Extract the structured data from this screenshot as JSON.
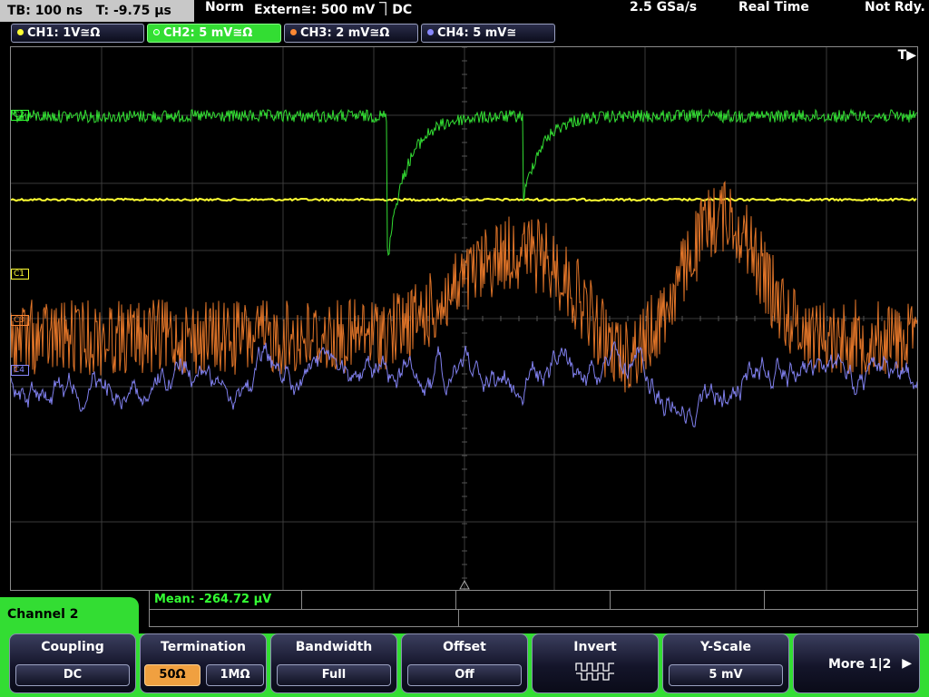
{
  "topbar": {
    "timebase": "TB: 100 ns",
    "trigger_time": "T: -9.75 µs",
    "mode": "Norm",
    "trigger_source": "Extern≅: 500 mV ⏋DC",
    "sample_rate": "2.5 GSa/s",
    "acq_mode": "Real Time",
    "status": "Not Rdy."
  },
  "channels": [
    {
      "label": "CH1: 1V≅Ω",
      "color": "#ffff33",
      "active": false
    },
    {
      "label": "CH2: 5 mV≅Ω",
      "color": "#33ff33",
      "active": true
    },
    {
      "label": "CH3: 2 mV≅Ω",
      "color": "#ff8833",
      "active": false
    },
    {
      "label": "CH4: 5 mV≅",
      "color": "#8888ff",
      "active": false
    }
  ],
  "markers": {
    "trigger_pos": "T▶",
    "c2": "C2",
    "c1": "C1",
    "c3": "C3",
    "c4": "C4"
  },
  "measurement": {
    "mean": "Mean: -264.72 µV"
  },
  "panel": {
    "title": "Channel 2"
  },
  "softkeys": {
    "coupling": {
      "title": "Coupling",
      "value": "DC"
    },
    "termination": {
      "title": "Termination",
      "option_a": "50Ω",
      "option_b": "1MΩ",
      "selected": "50Ω"
    },
    "bandwidth": {
      "title": "Bandwidth",
      "value": "Full"
    },
    "offset": {
      "title": "Offset",
      "value": "Off"
    },
    "invert": {
      "title": "Invert"
    },
    "yscale": {
      "title": "Y-Scale",
      "value": "5 mV"
    },
    "more": {
      "label": "More 1|2"
    }
  },
  "colors": {
    "ch1": "#ffff33",
    "ch2": "#33ff33",
    "ch3": "#ff8833",
    "ch4": "#8888ff",
    "menu_accent": "#33dd33"
  }
}
